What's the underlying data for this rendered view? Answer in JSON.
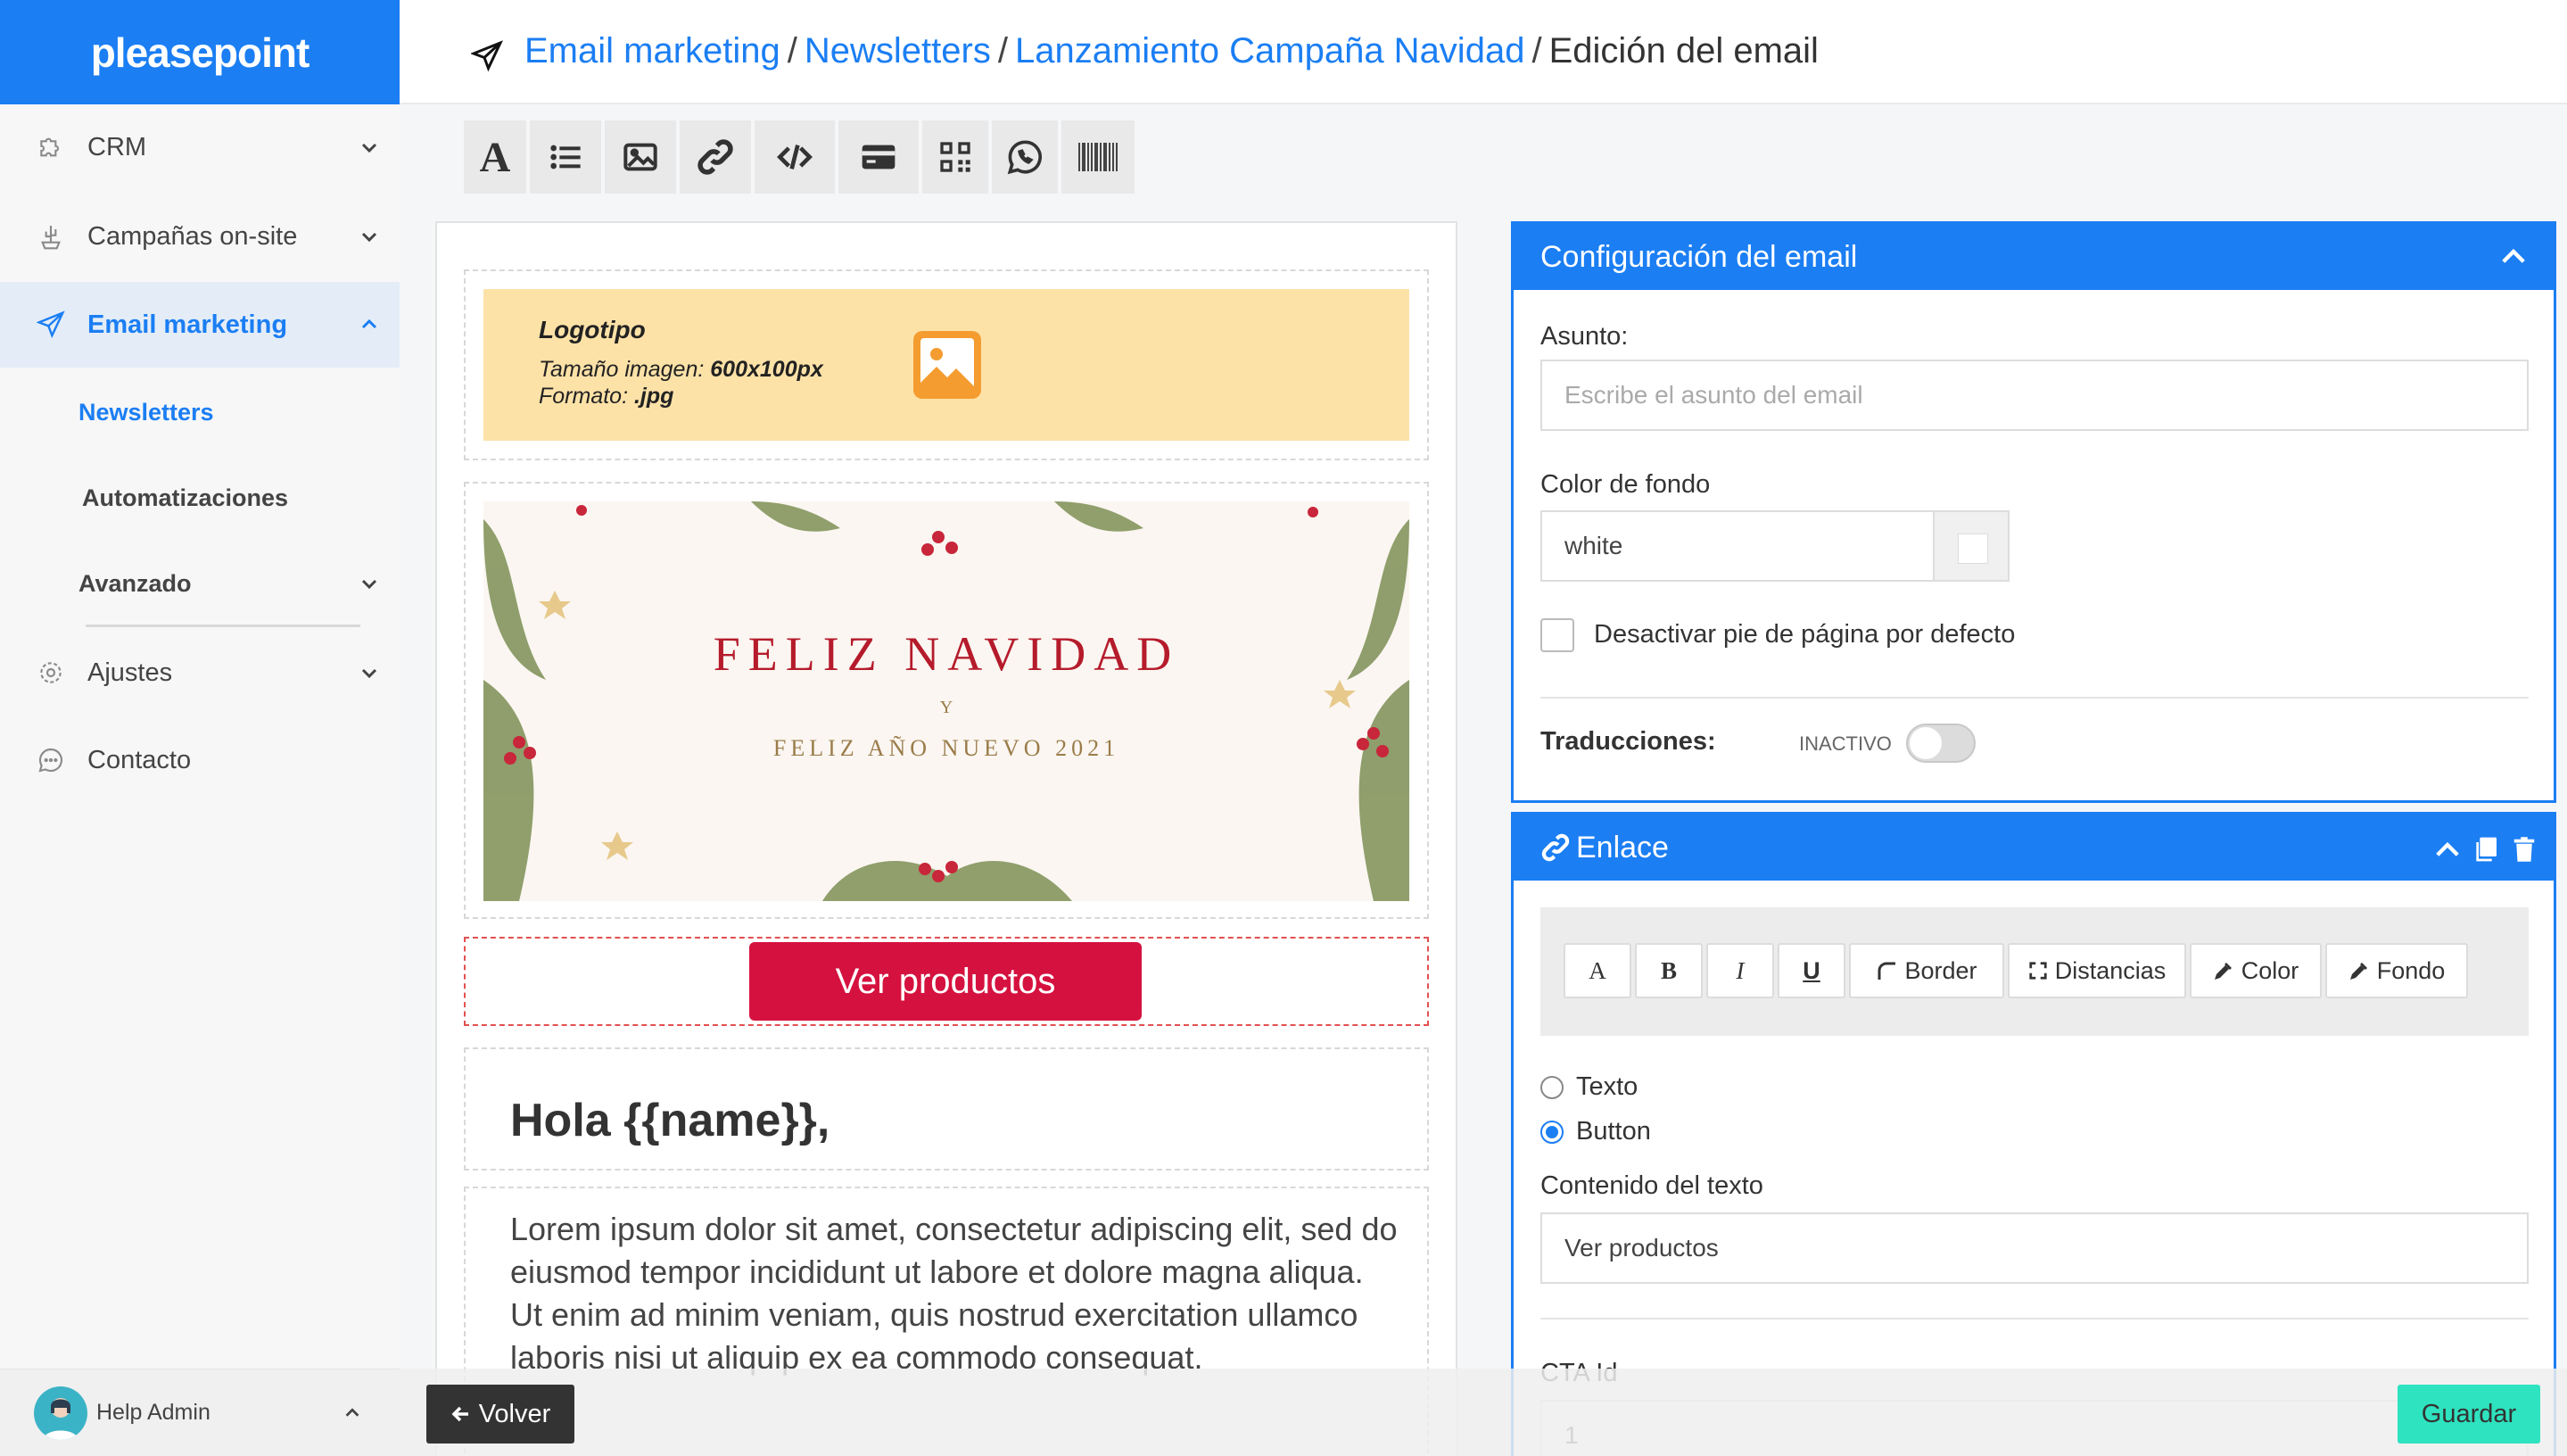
{
  "brand": {
    "name": "pleasepoint",
    "accent": "#1b7ef3",
    "cta_color": "#d5123f",
    "save_color": "#2ee3bf"
  },
  "sidebar": {
    "items": [
      {
        "label": "CRM",
        "icon": "puzzle-icon"
      },
      {
        "label": "Campañas on-site",
        "icon": "cactus-icon"
      },
      {
        "label": "Email marketing",
        "icon": "paper-plane-icon"
      },
      {
        "label": "Ajustes",
        "icon": "gear-icon"
      },
      {
        "label": "Contacto",
        "icon": "chat-bubble-icon"
      }
    ],
    "subitems": [
      {
        "label": "Newsletters"
      },
      {
        "label": "Automatizaciones"
      },
      {
        "label": "Avanzado"
      }
    ],
    "user": "Help Admin"
  },
  "breadcrumb": {
    "links": [
      "Email marketing",
      "Newsletters",
      "Lanzamiento Campaña Navidad"
    ],
    "current": "Edición del email",
    "separator": "/"
  },
  "toolbar": {
    "items": [
      "text-icon",
      "list-icon",
      "image-icon",
      "link-icon",
      "code-icon",
      "card-icon",
      "qr-code-icon",
      "whatsapp-icon",
      "barcode-icon"
    ]
  },
  "canvas": {
    "logo_block": {
      "title": "Logotipo",
      "size_label": "Tamaño imagen:",
      "size_value": "600x100px",
      "format_label": "Formato:",
      "format_value": ".jpg"
    },
    "banner": {
      "line1": "FELIZ NAVIDAD",
      "line2": "Y",
      "line3": "FELIZ AÑO NUEVO 2021"
    },
    "cta_label": "Ver productos",
    "greeting": "Hola {{name}},",
    "body_text": "Lorem ipsum dolor sit amet, consectetur adipiscing elit, sed do eiusmod tempor incididunt ut labore et dolore magna aliqua. Ut enim ad minim veniam, quis nostrud exercitation ullamco laboris nisi ut aliquip ex ea commodo consequat."
  },
  "config_panel": {
    "title": "Configuración del email",
    "subject_label": "Asunto:",
    "subject_placeholder": "Escribe el asunto del email",
    "bg_label": "Color de fondo",
    "bg_value": "white",
    "footer_checkbox": "Desactivar pie de página por defecto",
    "translations_label": "Traducciones:",
    "translations_state": "INACTIVO"
  },
  "link_panel": {
    "title": "Enlace",
    "format_buttons": [
      "A",
      "B",
      "I",
      "U",
      "Border",
      "Distancias",
      "Color",
      "Fondo"
    ],
    "type_options": [
      "Texto",
      "Button"
    ],
    "selected_type": "Button",
    "content_label": "Contenido del texto",
    "content_value": "Ver productos",
    "cta_id_label": "CTA Id",
    "cta_id_value": "1"
  },
  "footer": {
    "back_label": "Volver",
    "save_label": "Guardar"
  }
}
